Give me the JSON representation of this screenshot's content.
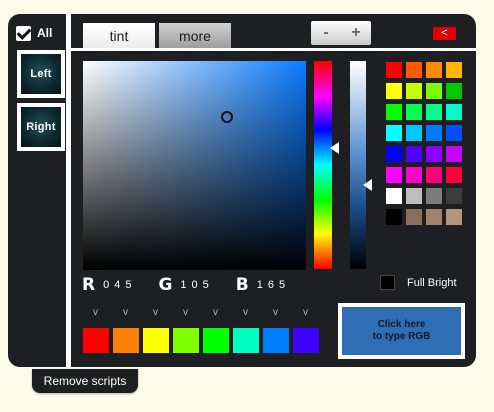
{
  "left": {
    "all_label": "All",
    "left_button": "Left",
    "right_button": "Right"
  },
  "tabs": [
    {
      "label": "tint"
    },
    {
      "label": "more"
    }
  ],
  "zoom": {
    "minus": "-",
    "plus": "+"
  },
  "close_label": "<",
  "picker": {
    "hue_gradient": [
      "#ff0000",
      "#ff00ff",
      "#0000ff",
      "#00ffff",
      "#00ff00",
      "#ffff00",
      "#ff0000"
    ],
    "selected_base_color": "#0a7bff"
  },
  "swatches": [
    "#ff0000",
    "#ff5a00",
    "#ff8c00",
    "#ffb400",
    "#ffff00",
    "#c8ff00",
    "#78ff00",
    "#00c800",
    "#00ff00",
    "#00ff50",
    "#00ff8c",
    "#00ffc8",
    "#00ffff",
    "#00c8ff",
    "#0078ff",
    "#0050ff",
    "#0000ff",
    "#5000ff",
    "#8c00ff",
    "#c800ff",
    "#ff00ff",
    "#ff00c8",
    "#ff0078",
    "#ff003c",
    "#ffffff",
    "#bebebe",
    "#7d7d7d",
    "#3c3c3c",
    "#000000",
    "#8c6e5a",
    "#a0826e",
    "#b4967d"
  ],
  "rgb": {
    "r_label": "R",
    "r_value": "045",
    "g_label": "G",
    "g_value": "105",
    "b_label": "B",
    "b_value": "165"
  },
  "full_bright_label": "Full Bright",
  "preset_arrow": "v",
  "presets": [
    "#ff0000",
    "#ff8000",
    "#ffff00",
    "#80ff00",
    "#00ff00",
    "#00ffc0",
    "#0080ff",
    "#4000ff"
  ],
  "type_rgb": {
    "line1": "Click here",
    "line2": "to type RGB"
  },
  "remove_scripts_label": "Remove scripts"
}
